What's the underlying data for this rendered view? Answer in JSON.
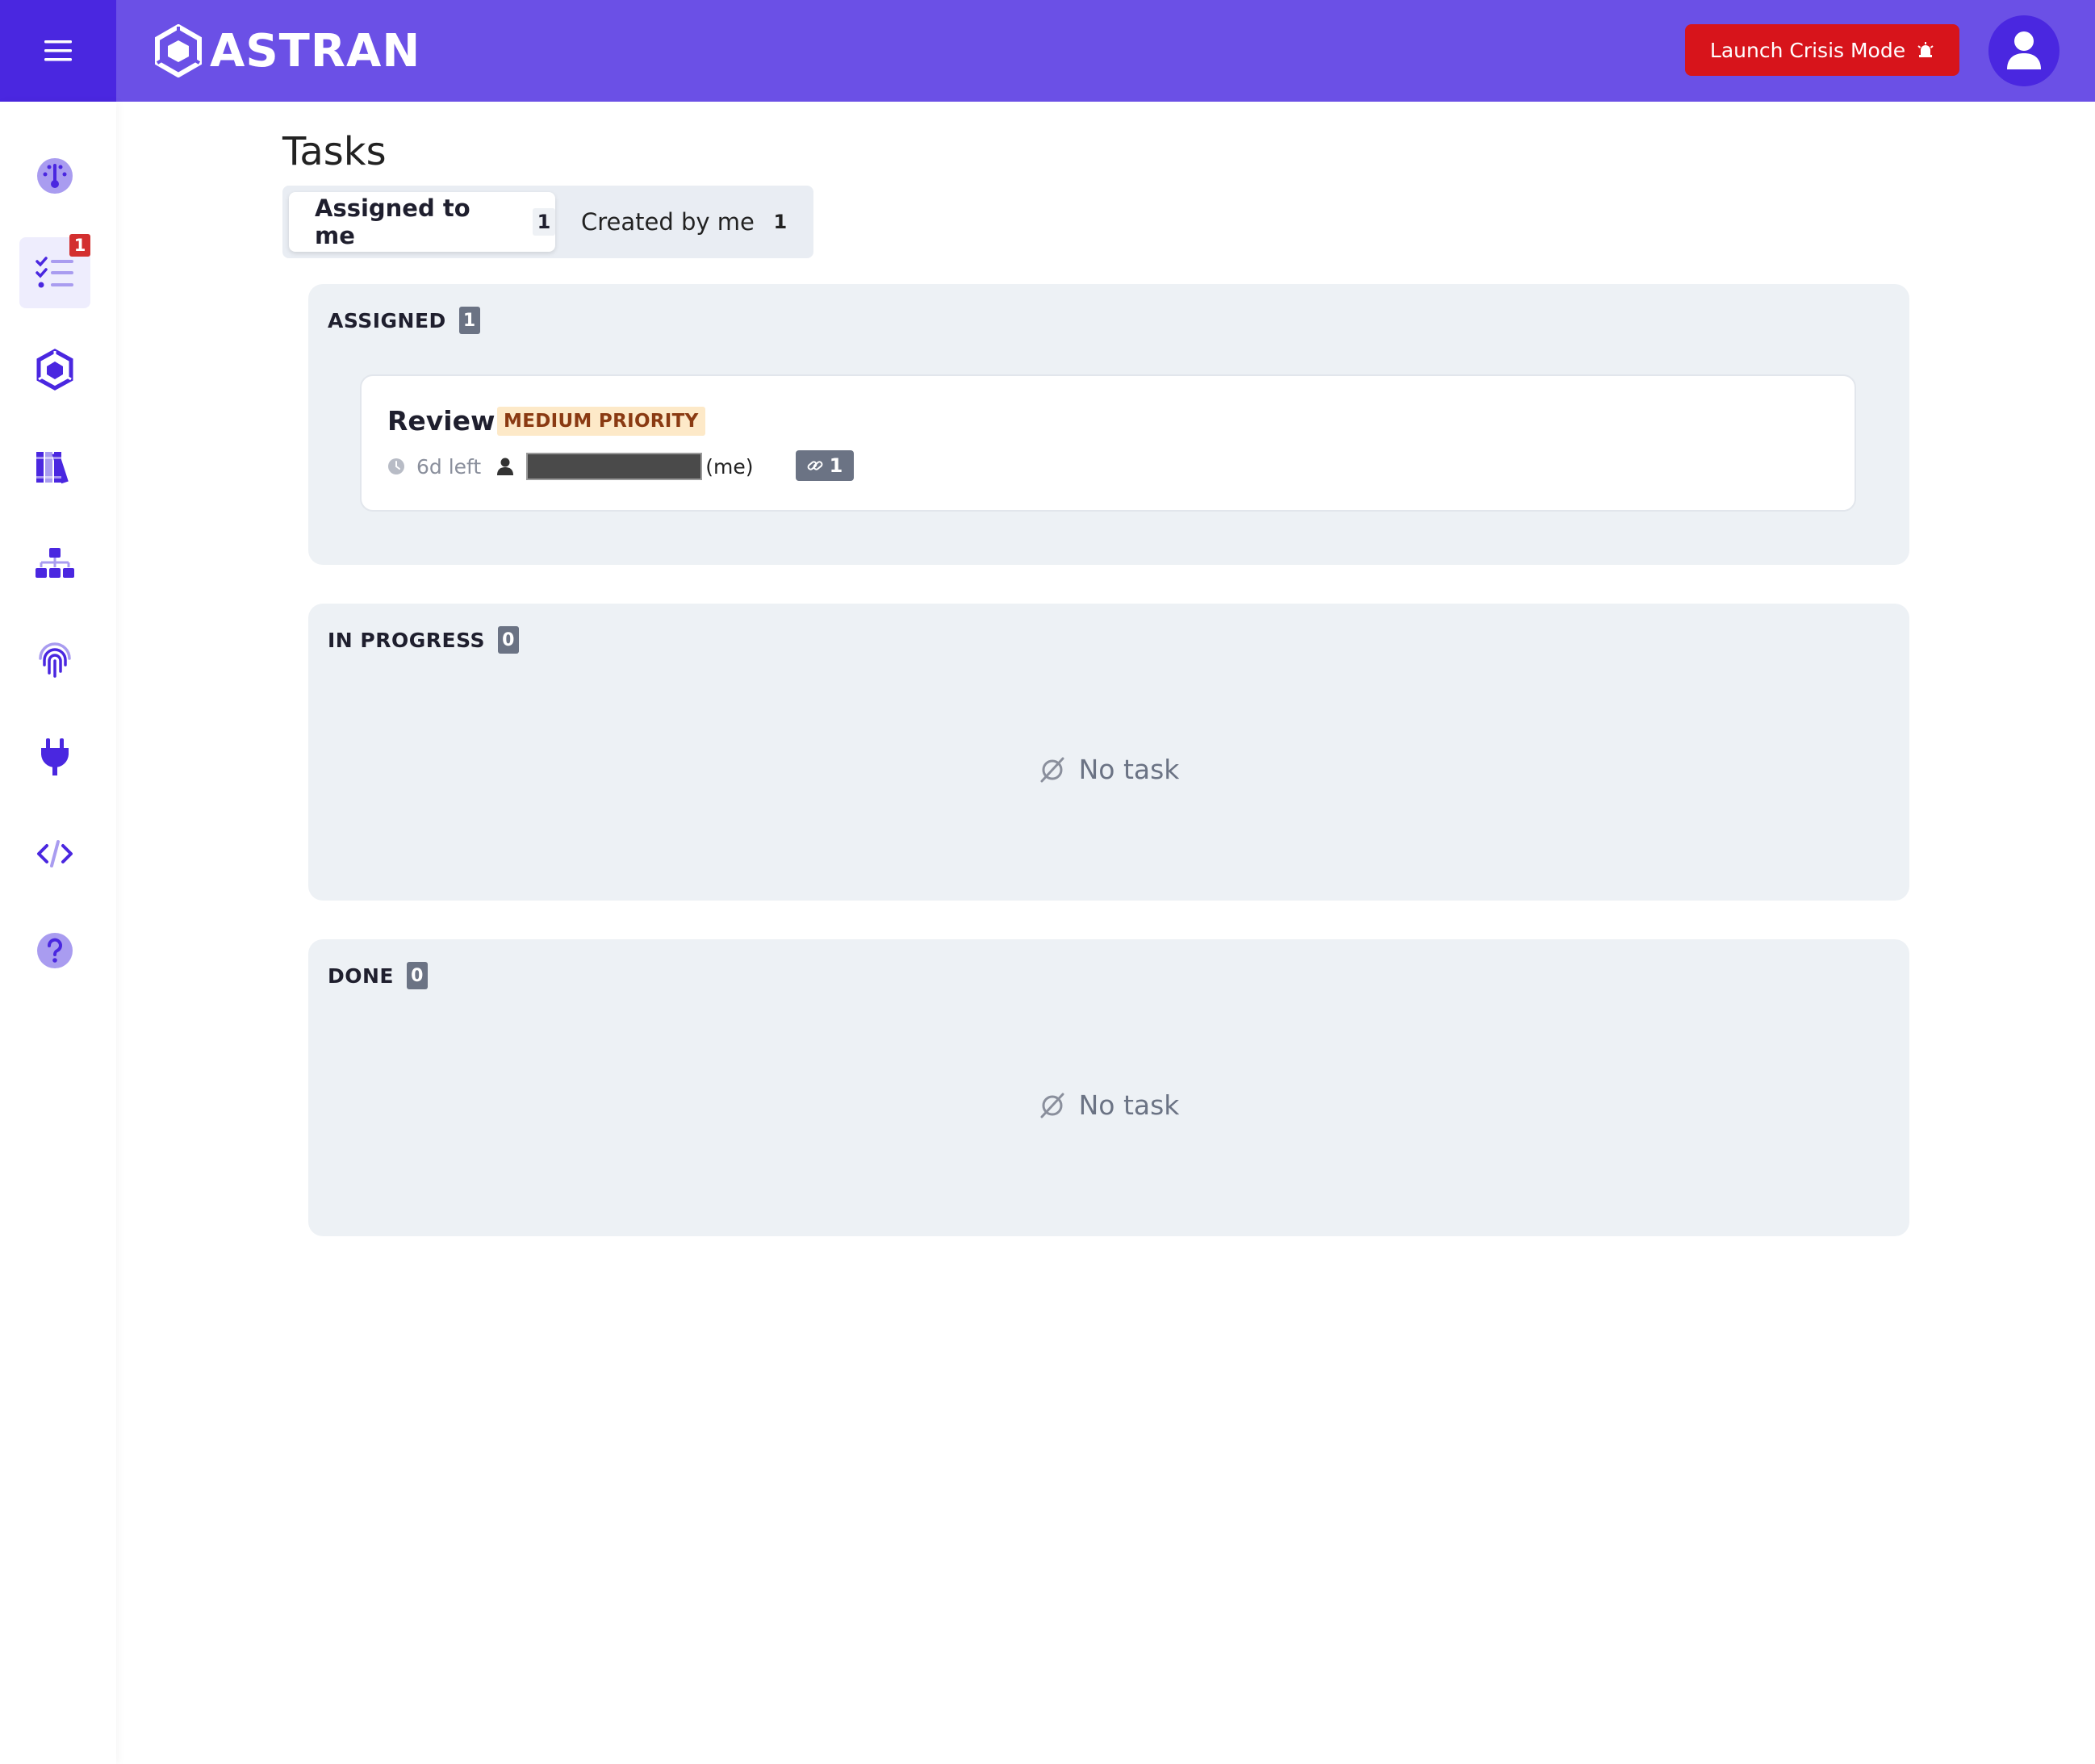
{
  "header": {
    "logo_text": "ASTRAN",
    "crisis_button_label": "Launch Crisis Mode",
    "colors": {
      "bar": "#6b50e6",
      "menu_bg": "#4a27e0",
      "crisis": "#d7141b"
    }
  },
  "sidebar": {
    "items": [
      {
        "icon": "gauge-icon"
      },
      {
        "icon": "task-list-icon",
        "active": true,
        "badge": "1"
      },
      {
        "icon": "astran-cube-icon"
      },
      {
        "icon": "library-books-icon"
      },
      {
        "icon": "org-chart-icon"
      },
      {
        "icon": "fingerprint-icon"
      },
      {
        "icon": "plug-icon"
      },
      {
        "icon": "code-icon"
      },
      {
        "icon": "help-circle-icon"
      }
    ]
  },
  "page": {
    "title": "Tasks",
    "tabs": [
      {
        "label": "Assigned to me",
        "count": "1",
        "selected": true
      },
      {
        "label": "Created by me",
        "count": "1",
        "selected": false
      }
    ]
  },
  "columns": {
    "assigned": {
      "title": "ASSIGNED",
      "count": "1",
      "task": {
        "title": "Review",
        "priority": "MEDIUM PRIORITY",
        "due": "6d left",
        "assignee_suffix": "(me)",
        "links_count": "1"
      }
    },
    "in_progress": {
      "title": "IN PROGRESS",
      "count": "0",
      "empty_text": "No task"
    },
    "done": {
      "title": "DONE",
      "count": "0",
      "empty_text": "No task"
    }
  }
}
